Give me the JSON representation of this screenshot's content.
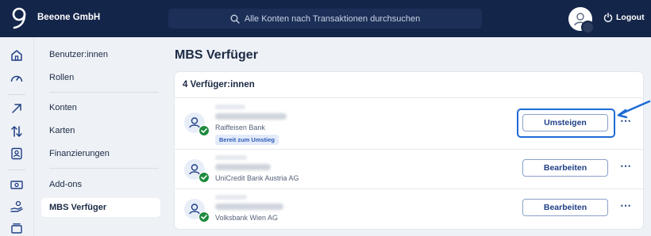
{
  "header": {
    "company": "Beeone GmbH",
    "search_placeholder": "Alle Konten nach Transaktionen durchsuchen",
    "logout_label": "Logout"
  },
  "rail_icons": [
    "home-icon",
    "dashboard-icon",
    "transfer-arrow-icon",
    "exchange-icon",
    "contact-card-icon",
    "banknote-icon",
    "hand-coin-icon",
    "stack-icon"
  ],
  "sidebar": {
    "items": [
      {
        "label": "Benutzer:innen"
      },
      {
        "label": "Rollen"
      },
      {
        "label": "Konten"
      },
      {
        "label": "Karten"
      },
      {
        "label": "Finanzierungen"
      },
      {
        "label": "Add-ons"
      },
      {
        "label": "MBS Verfüger"
      }
    ],
    "active": "MBS Verfüger"
  },
  "main": {
    "title": "MBS Verfüger",
    "count_label": "4 Verfüger:innen",
    "rows": [
      {
        "bank": "Raiffeisen Bank",
        "badge": "Bereit zum Umstieg",
        "action": "Umsteigen"
      },
      {
        "bank": "UniCredit Bank Austria AG",
        "action": "Bearbeiten"
      },
      {
        "bank": "Volksbank Wien AG",
        "action": "Bearbeiten"
      }
    ]
  },
  "colors": {
    "topbar": "#14254a",
    "accent": "#1e6bd6",
    "check": "#1e8a3e"
  }
}
